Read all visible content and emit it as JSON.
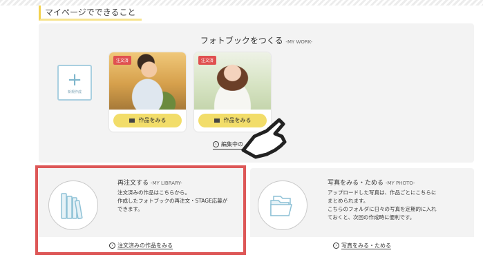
{
  "section": {
    "title": "マイページでできること"
  },
  "my_work": {
    "title": "フォトブックをつくる",
    "subtitle": "-MY WORK-",
    "new_label": "新規作成",
    "new_icon": "plus-icon",
    "works": [
      {
        "badge": "注文済",
        "button": "作品をみる"
      },
      {
        "badge": "注文済",
        "button": "作品をみる"
      }
    ],
    "edit_link": "編集中の"
  },
  "my_library": {
    "title": "再注文する",
    "subtitle": "-MY LIBRARY-",
    "lines": [
      "注文済みの作品はこちらから。",
      "作成したフォトブックの再注文・STAGE応募が",
      "できます。"
    ],
    "link": "注文済みの作品をみる"
  },
  "my_photo": {
    "title": "写真をみる・ためる",
    "subtitle": "-MY PHOTO-",
    "lines": [
      "アップロードした写真は、作品ごとにこちらに",
      "まとめられます。",
      "こちらのフォルダに日々の写真を定期的に入れ",
      "ておくと、次回の作成時に便利です。"
    ],
    "link": "写真をみる・ためる"
  },
  "colors": {
    "accent_yellow": "#f2dd6a",
    "highlight_red": "#dd5757",
    "icon_blue": "#a9cfe0"
  }
}
